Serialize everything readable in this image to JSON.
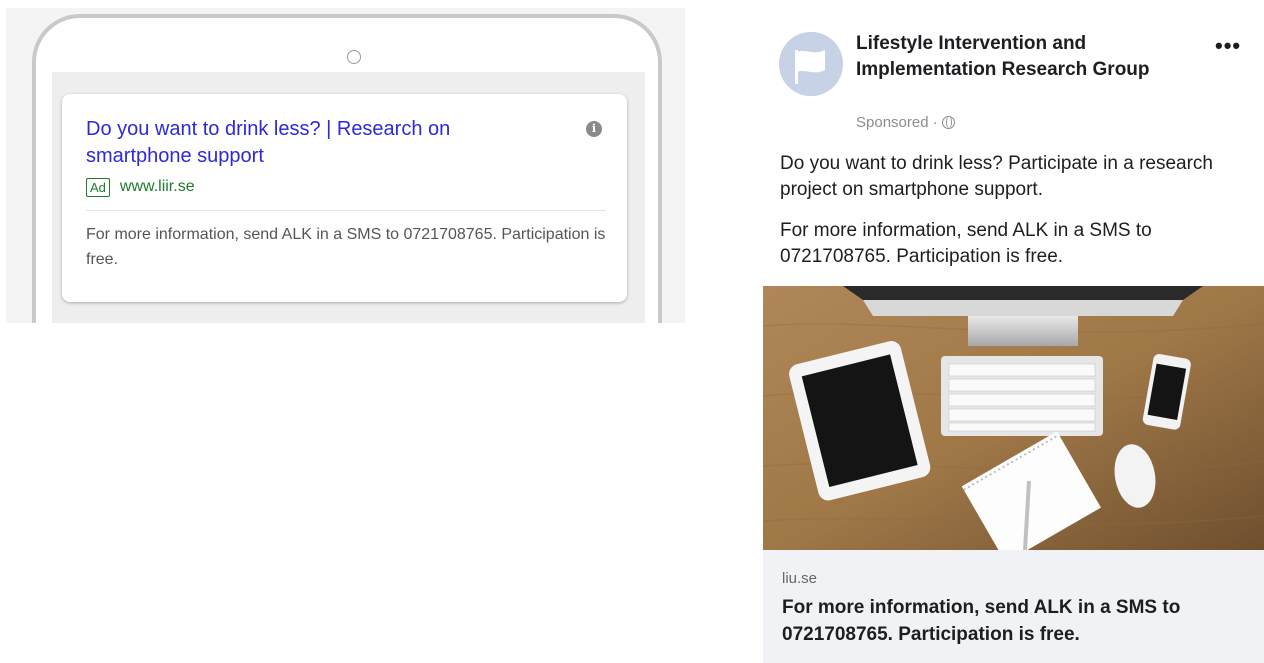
{
  "google_ad": {
    "title": "Do you want to drink less? | Research on smartphone support",
    "badge": "Ad",
    "url": "www.liir.se",
    "description": "For more information, send ALK in a SMS to 0721708765. Participation is free.",
    "info_icon": "i"
  },
  "facebook_ad": {
    "page_name": "Lifestyle Intervention and Implementation Research Group",
    "sponsored": "Sponsored ·",
    "more_icon": "•••",
    "text_1": "Do you want to drink less? Participate in a research project on smartphone support.",
    "text_2": "For more information, send ALK in a SMS to 0721708765. Participation is free.",
    "link_domain": "liu.se",
    "link_headline": "For more information, send ALK in a SMS to 0721708765. Participation is free."
  },
  "colors": {
    "google_link": "#2b2ad8",
    "google_url": "#1e7a2e",
    "fb_text": "#1c1e21",
    "fb_link_bg": "#f0f2f5"
  }
}
